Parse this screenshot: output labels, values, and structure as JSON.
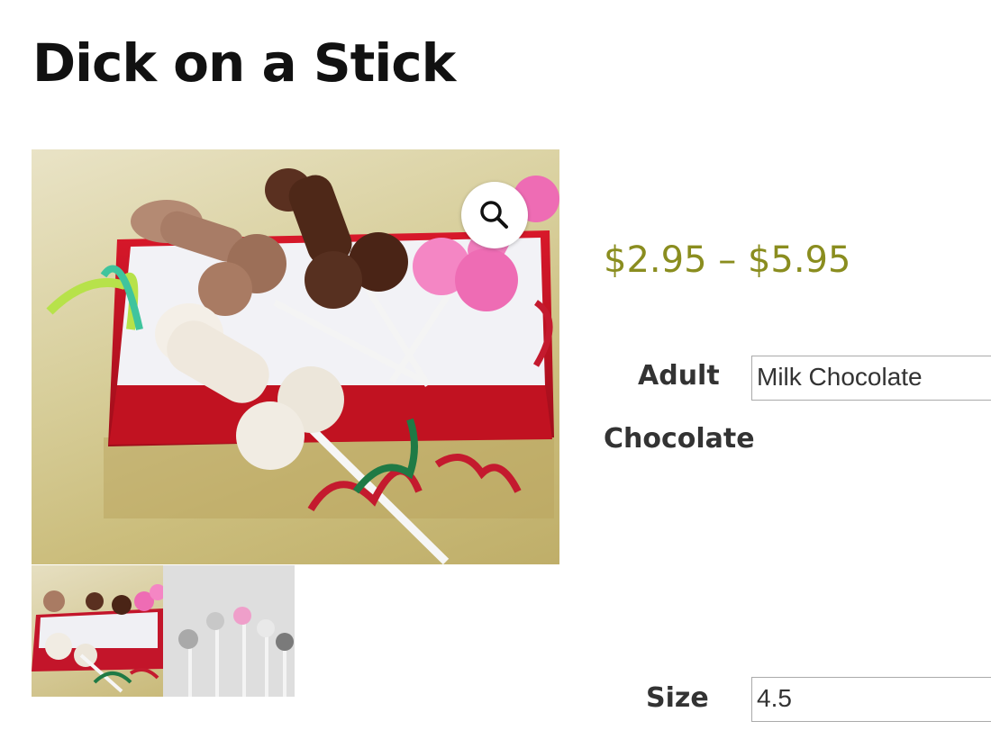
{
  "product": {
    "title": "Dick on a Stick",
    "price_range": "$2.95 – $5.95"
  },
  "gallery": {
    "zoom_icon": "magnifier-icon",
    "thumbnail_count": 2
  },
  "options": {
    "chocolate": {
      "label_line1": "Adult",
      "label_line2": "Chocolate",
      "selected": "Milk Chocolate"
    },
    "size": {
      "label": "Size",
      "selected": "4.5"
    }
  },
  "colors": {
    "price": "#8a8d1f",
    "title": "#111111"
  }
}
